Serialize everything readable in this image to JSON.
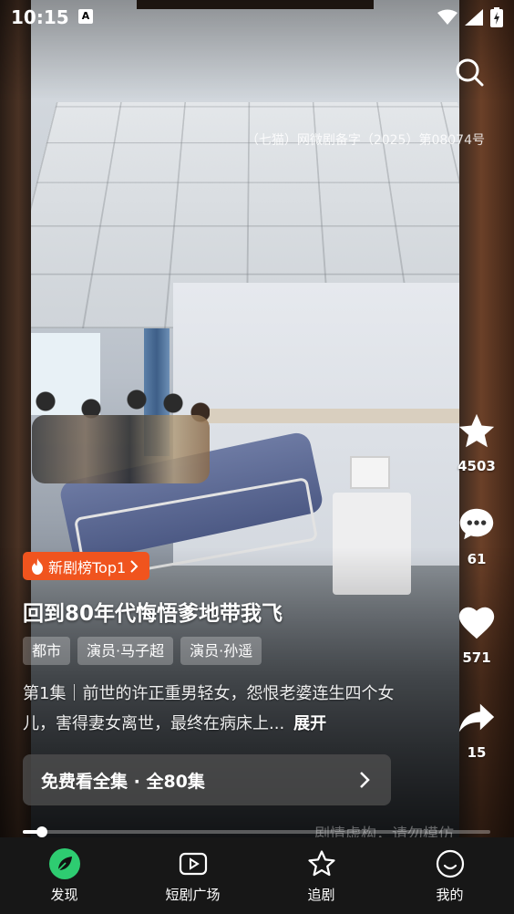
{
  "status_bar": {
    "time": "10:15",
    "notification": "A"
  },
  "license_text": "（七猫）网微剧备字（2025）第08074号",
  "actions": {
    "favorite_count": "4503",
    "comment_count": "61",
    "like_count": "571",
    "share_count": "15"
  },
  "rank_badge": "新剧榜Top1",
  "drama": {
    "title": "回到80年代悔悟爹地带我飞",
    "tags": [
      "都市",
      "演员·马子超",
      "演员·孙遥"
    ],
    "description": "第1集｜前世的许正重男轻女，怨恨老婆连生四个女儿，害得妻女离世，最终在病床上...",
    "expand_label": "展开"
  },
  "watch_all_label": "免费看全集 · 全80集",
  "playback": {
    "progress": 0.04
  },
  "disclaimer": "剧情虚构，请勿模仿",
  "bottom_nav": [
    {
      "label": "发现",
      "icon": "leaf-icon",
      "active": true
    },
    {
      "label": "短剧广场",
      "icon": "play-square-icon",
      "active": false
    },
    {
      "label": "追剧",
      "icon": "star-outline-icon",
      "active": false
    },
    {
      "label": "我的",
      "icon": "smile-icon",
      "active": false
    }
  ],
  "colors": {
    "accent_green": "#2ecc71",
    "badge_orange": "#f0541e"
  }
}
